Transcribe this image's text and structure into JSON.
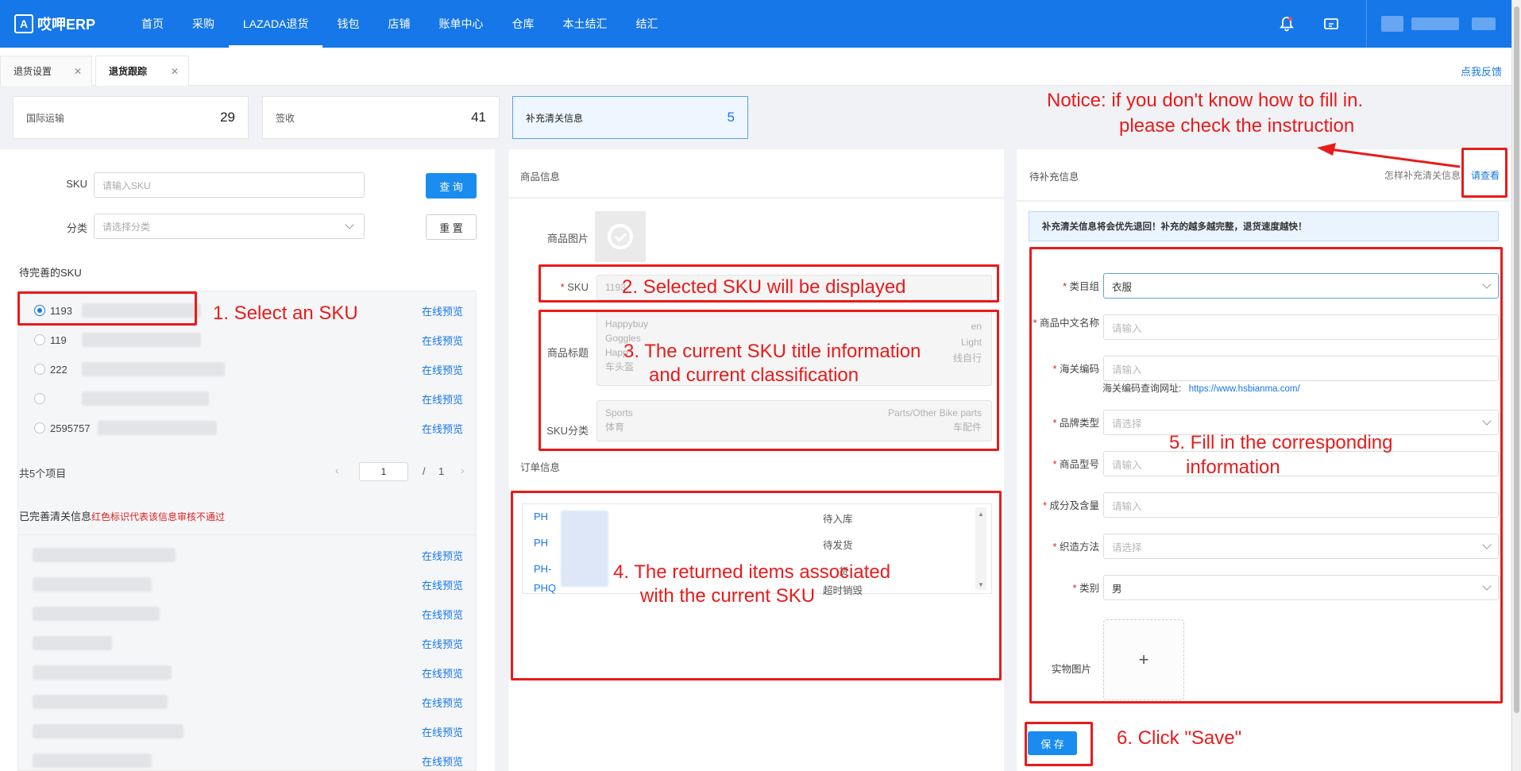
{
  "topnav": {
    "logo": "哎呷ERP",
    "items": [
      "首页",
      "采购",
      "LAZADA退货",
      "钱包",
      "店铺",
      "账单中心",
      "仓库",
      "本土结汇",
      "结汇"
    ],
    "active_index": 2,
    "icons": [
      "bell-icon",
      "message-icon"
    ]
  },
  "tabs": [
    {
      "label": "退货设置",
      "active": false
    },
    {
      "label": "退货跟踪",
      "active": true
    }
  ],
  "feedback": "点我反馈",
  "stats": [
    {
      "label": "国际运输",
      "value": "29",
      "selected": false
    },
    {
      "label": "签收",
      "value": "41",
      "selected": false
    },
    {
      "label": "补充清关信息",
      "value": "5",
      "selected": true
    }
  ],
  "left": {
    "sku_label": "SKU",
    "sku_placeholder": "请输入SKU",
    "category_label": "分类",
    "category_placeholder": "请选择分类",
    "search_btn": "查 询",
    "reset_btn": "重 置",
    "pending_title": "待完善的SKU",
    "pending_items": [
      {
        "sku": "1193",
        "selected": true
      },
      {
        "sku": "119",
        "selected": false
      },
      {
        "sku": "222",
        "selected": false
      },
      {
        "sku": "",
        "selected": false
      },
      {
        "sku": "2595757",
        "selected": false
      }
    ],
    "preview_link": "在线预览",
    "total": "共5个项目",
    "page": "1",
    "page_sep": "/",
    "page_total": "1",
    "done_title": "已完善清关信息",
    "done_note": "红色标识代表该信息审核不通过",
    "done_count": 8
  },
  "middle": {
    "product_info_title": "商品信息",
    "image_label": "商品图片",
    "sku_label": "SKU",
    "sku_value": "1193",
    "title_label": "商品标题",
    "title_lines": [
      "Happybuy",
      "Goggles",
      "Happ",
      "车头盔"
    ],
    "title_right": [
      "en",
      "Light",
      "线自行"
    ],
    "category_label": "SKU分类",
    "category_lines": [
      "Sports",
      "体育"
    ],
    "category_right": [
      "Parts/Other Bike parts",
      "车配件"
    ],
    "order_info_title": "订单信息",
    "orders": [
      {
        "id": "PH",
        "status": "待入库"
      },
      {
        "id": "PH",
        "status": "待发货"
      },
      {
        "id": "PH-",
        "status": "货"
      },
      {
        "id": "PHQ",
        "status": "超时销毁"
      }
    ]
  },
  "right": {
    "title": "待补充信息",
    "howto": "怎样补充清关信息",
    "check_link": "请查看",
    "notice": "补充清关信息将会优先退回！补充的越多越完整，退货速度越快！",
    "fields": [
      {
        "label": "类目组",
        "value": "衣服",
        "placeholder": "",
        "type": "select"
      },
      {
        "label": "商品中文名称",
        "value": "",
        "placeholder": "请输入",
        "type": "input"
      },
      {
        "label": "海关编码",
        "value": "",
        "placeholder": "请输入",
        "type": "input"
      },
      {
        "label": "品牌类型",
        "value": "",
        "placeholder": "请选择",
        "type": "select"
      },
      {
        "label": "商品型号",
        "value": "",
        "placeholder": "请输入",
        "type": "input"
      },
      {
        "label": "成分及含量",
        "value": "",
        "placeholder": "请输入",
        "type": "input"
      },
      {
        "label": "织造方法",
        "value": "",
        "placeholder": "请选择",
        "type": "select"
      },
      {
        "label": "类别",
        "value": "男",
        "placeholder": "",
        "type": "select"
      }
    ],
    "hs_query_label": "海关编码查询网址:",
    "hs_query_url": "https://www.hsbianma.com/",
    "photo_label": "实物图片",
    "upload_plus": "+",
    "save_btn": "保 存"
  },
  "annotations": {
    "notice_line1": "Notice: if you don't know how to fill in.",
    "notice_line2": "please check the instruction",
    "a1": "1. Select an SKU",
    "a2": "2. Selected SKU will be displayed",
    "a3_line1": "3. The current SKU title information",
    "a3_line2": "and current classification",
    "a4_line1": "4. The returned items associated",
    "a4_line2": "with the current SKU",
    "a5_line1": "5. Fill in the corresponding",
    "a5_line2": "information",
    "a6": "6. Click \"Save\""
  }
}
